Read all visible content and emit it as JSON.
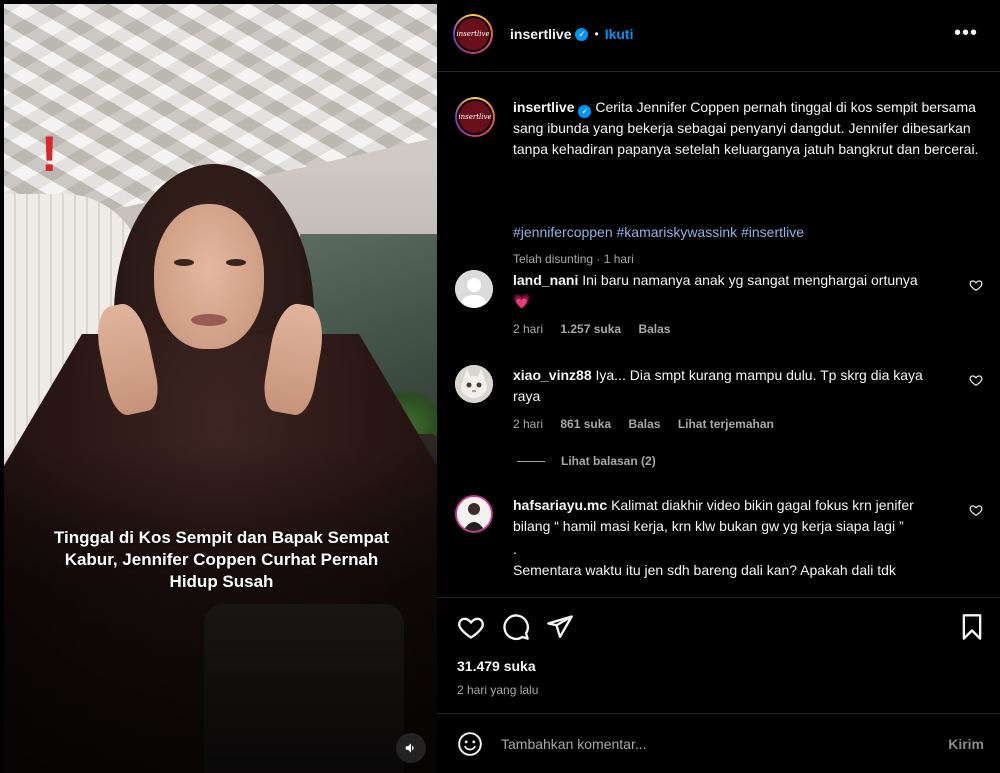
{
  "media": {
    "headline": "Tinggal di Kos Sempit dan Bapak Sempat Kabur, Jennifer Coppen Curhat Pernah Hidup Susah",
    "alert_mark": "!",
    "sound_icon": "speaker-icon"
  },
  "post": {
    "account": "insertlive",
    "follow_label": "Ikuti",
    "avatar_text": "insertlive",
    "more_icon": "more-horizontal-icon"
  },
  "caption": {
    "username": "insertlive",
    "text": "Cerita Jennifer Coppen pernah tinggal di kos sempit bersama sang ibunda yang bekerja sebagai penyanyi dangdut. Jennifer dibesarkan tanpa kehadiran papanya setelah keluarganya jatuh bangkrut dan bercerai.",
    "hashtags": "#jennifercoppen #kamariskywassink #insertlive",
    "edited": "Telah disunting",
    "time": "1 hari"
  },
  "comments": [
    {
      "username": "land_nani",
      "text": "Ini baru namanya anak yg sangat menghargai ortunya 💗",
      "time": "2 hari",
      "likes": "1.257 suka",
      "reply": "Balas"
    },
    {
      "username": "xiao_vinz88",
      "text": "Iya... Dia smpt kurang mampu dulu. Tp skrg dia kaya raya",
      "time": "2 hari",
      "likes": "861 suka",
      "reply": "Balas",
      "translate": "Lihat terjemahan",
      "view_replies": "Lihat balasan (2)"
    },
    {
      "username": "hafsariayu.mc",
      "text": "Kalimat diakhir video bikin gagal fokus krn jenifer bilang “ hamil masi kerja, krn klw bukan gw yg kerja siapa lagi ”",
      "text_dot": ".",
      "text_more": "Sementara waktu itu jen sdh bareng dali kan? Apakah dali tdk"
    }
  ],
  "actions": {
    "likes": "31.479 suka",
    "posted": "2 hari yang lalu"
  },
  "composer": {
    "placeholder": "Tambahkan komentar...",
    "send_label": "Kirim"
  },
  "colors": {
    "background": "#000000",
    "link_blue": "#0095f6",
    "hashtag_blue": "#8fb4e6",
    "muted_text": "#a8a8a8",
    "alert_red": "#d9262a"
  }
}
